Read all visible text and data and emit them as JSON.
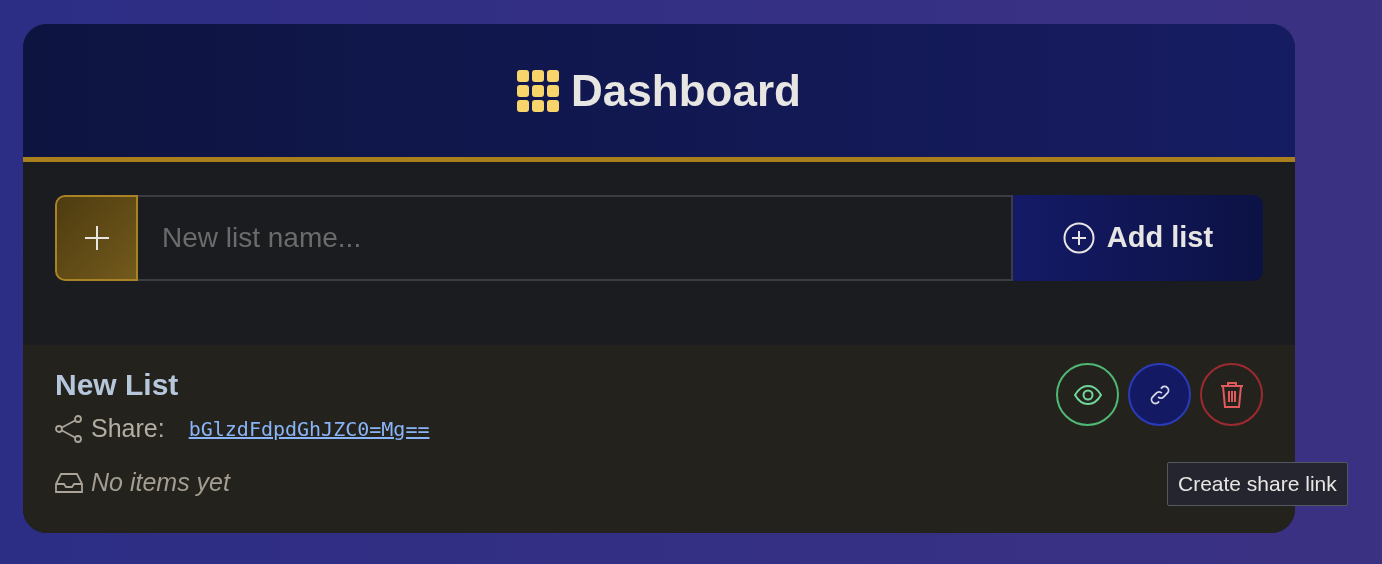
{
  "header": {
    "title": "Dashboard"
  },
  "new_list_form": {
    "placeholder": "New list name...",
    "add_button": "Add list"
  },
  "lists": [
    {
      "name": "New List",
      "share_label": "Share:",
      "share_code": "bGlzdFdpdGhJZC0=Mg==",
      "empty_text": "No items yet",
      "actions": [
        {
          "kind": "view"
        },
        {
          "kind": "share"
        },
        {
          "kind": "delete"
        }
      ]
    }
  ],
  "tooltip": {
    "text": "Create share link"
  }
}
